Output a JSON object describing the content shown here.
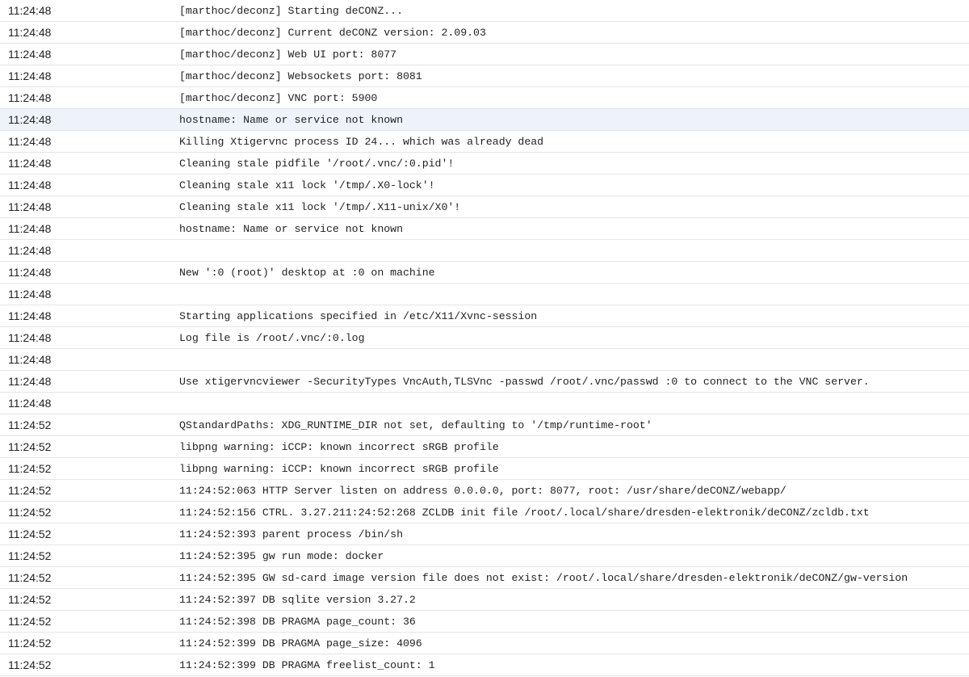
{
  "log": {
    "rows": [
      {
        "time": "11:24:48",
        "message": "[marthoc/deconz] Starting deCONZ..."
      },
      {
        "time": "11:24:48",
        "message": "[marthoc/deconz] Current deCONZ version: 2.09.03"
      },
      {
        "time": "11:24:48",
        "message": "[marthoc/deconz] Web UI port: 8077"
      },
      {
        "time": "11:24:48",
        "message": "[marthoc/deconz] Websockets port: 8081"
      },
      {
        "time": "11:24:48",
        "message": "[marthoc/deconz] VNC port: 5900"
      },
      {
        "time": "11:24:48",
        "message": "hostname: Name or service not known",
        "highlight": true
      },
      {
        "time": "11:24:48",
        "message": "Killing Xtigervnc process ID 24... which was already dead"
      },
      {
        "time": "11:24:48",
        "message": "Cleaning stale pidfile '/root/.vnc/:0.pid'!"
      },
      {
        "time": "11:24:48",
        "message": "Cleaning stale x11 lock '/tmp/.X0-lock'!"
      },
      {
        "time": "11:24:48",
        "message": "Cleaning stale x11 lock '/tmp/.X11-unix/X0'!"
      },
      {
        "time": "11:24:48",
        "message": "hostname: Name or service not known"
      },
      {
        "time": "11:24:48",
        "message": ""
      },
      {
        "time": "11:24:48",
        "message": "New ':0 (root)' desktop at :0 on machine"
      },
      {
        "time": "11:24:48",
        "message": ""
      },
      {
        "time": "11:24:48",
        "message": "Starting applications specified in /etc/X11/Xvnc-session"
      },
      {
        "time": "11:24:48",
        "message": "Log file is /root/.vnc/:0.log"
      },
      {
        "time": "11:24:48",
        "message": ""
      },
      {
        "time": "11:24:48",
        "message": "Use xtigervncviewer -SecurityTypes VncAuth,TLSVnc -passwd /root/.vnc/passwd :0 to connect to the VNC server."
      },
      {
        "time": "11:24:48",
        "message": ""
      },
      {
        "time": "11:24:52",
        "message": "QStandardPaths: XDG_RUNTIME_DIR not set, defaulting to '/tmp/runtime-root'"
      },
      {
        "time": "11:24:52",
        "message": "libpng warning: iCCP: known incorrect sRGB profile"
      },
      {
        "time": "11:24:52",
        "message": "libpng warning: iCCP: known incorrect sRGB profile"
      },
      {
        "time": "11:24:52",
        "message": "11:24:52:063 HTTP Server listen on address 0.0.0.0, port: 8077, root: /usr/share/deCONZ/webapp/"
      },
      {
        "time": "11:24:52",
        "message": "11:24:52:156 CTRL. 3.27.211:24:52:268 ZCLDB init file /root/.local/share/dresden-elektronik/deCONZ/zcldb.txt"
      },
      {
        "time": "11:24:52",
        "message": "11:24:52:393 parent process /bin/sh"
      },
      {
        "time": "11:24:52",
        "message": "11:24:52:395 gw run mode: docker"
      },
      {
        "time": "11:24:52",
        "message": "11:24:52:395 GW sd-card image version file does not exist: /root/.local/share/dresden-elektronik/deCONZ/gw-version"
      },
      {
        "time": "11:24:52",
        "message": "11:24:52:397 DB sqlite version 3.27.2"
      },
      {
        "time": "11:24:52",
        "message": "11:24:52:398 DB PRAGMA page_count: 36"
      },
      {
        "time": "11:24:52",
        "message": "11:24:52:399 DB PRAGMA page_size: 4096"
      },
      {
        "time": "11:24:52",
        "message": "11:24:52:399 DB PRAGMA freelist_count: 1"
      }
    ]
  }
}
